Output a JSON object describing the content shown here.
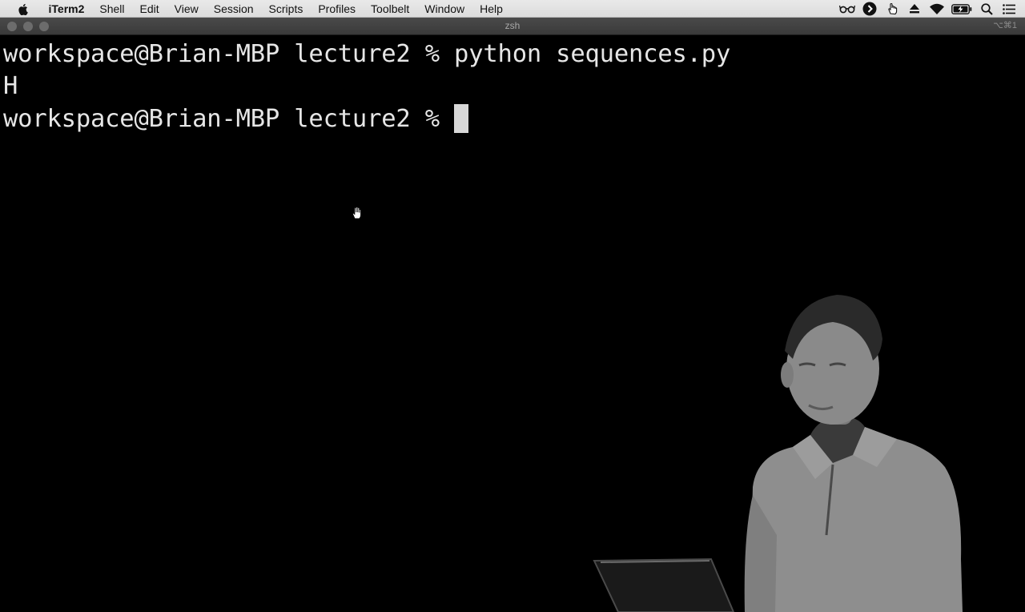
{
  "menubar": {
    "apple_icon": "apple-logo-icon",
    "items": [
      "iTerm2",
      "Shell",
      "Edit",
      "View",
      "Session",
      "Scripts",
      "Profiles",
      "Toolbelt",
      "Window",
      "Help"
    ],
    "tray_icons": [
      "glasses-icon",
      "play-circle-icon",
      "cursor-hand-icon",
      "eject-icon",
      "wifi-icon",
      "battery-charging-icon",
      "search-icon",
      "list-icon"
    ]
  },
  "window": {
    "title": "zsh",
    "shortcut": "⌥⌘1"
  },
  "terminal": {
    "lines": [
      {
        "prompt": "workspace@Brian-MBP lecture2 % ",
        "command": "python sequences.py"
      },
      {
        "output": "H"
      },
      {
        "prompt": "workspace@Brian-MBP lecture2 % ",
        "command": ""
      }
    ]
  },
  "colors": {
    "terminal_bg": "#000000",
    "terminal_text": "#e6e6e6",
    "titlebar_bg": "#3f3f3f",
    "menubar_bg": "#e2e2e2"
  }
}
